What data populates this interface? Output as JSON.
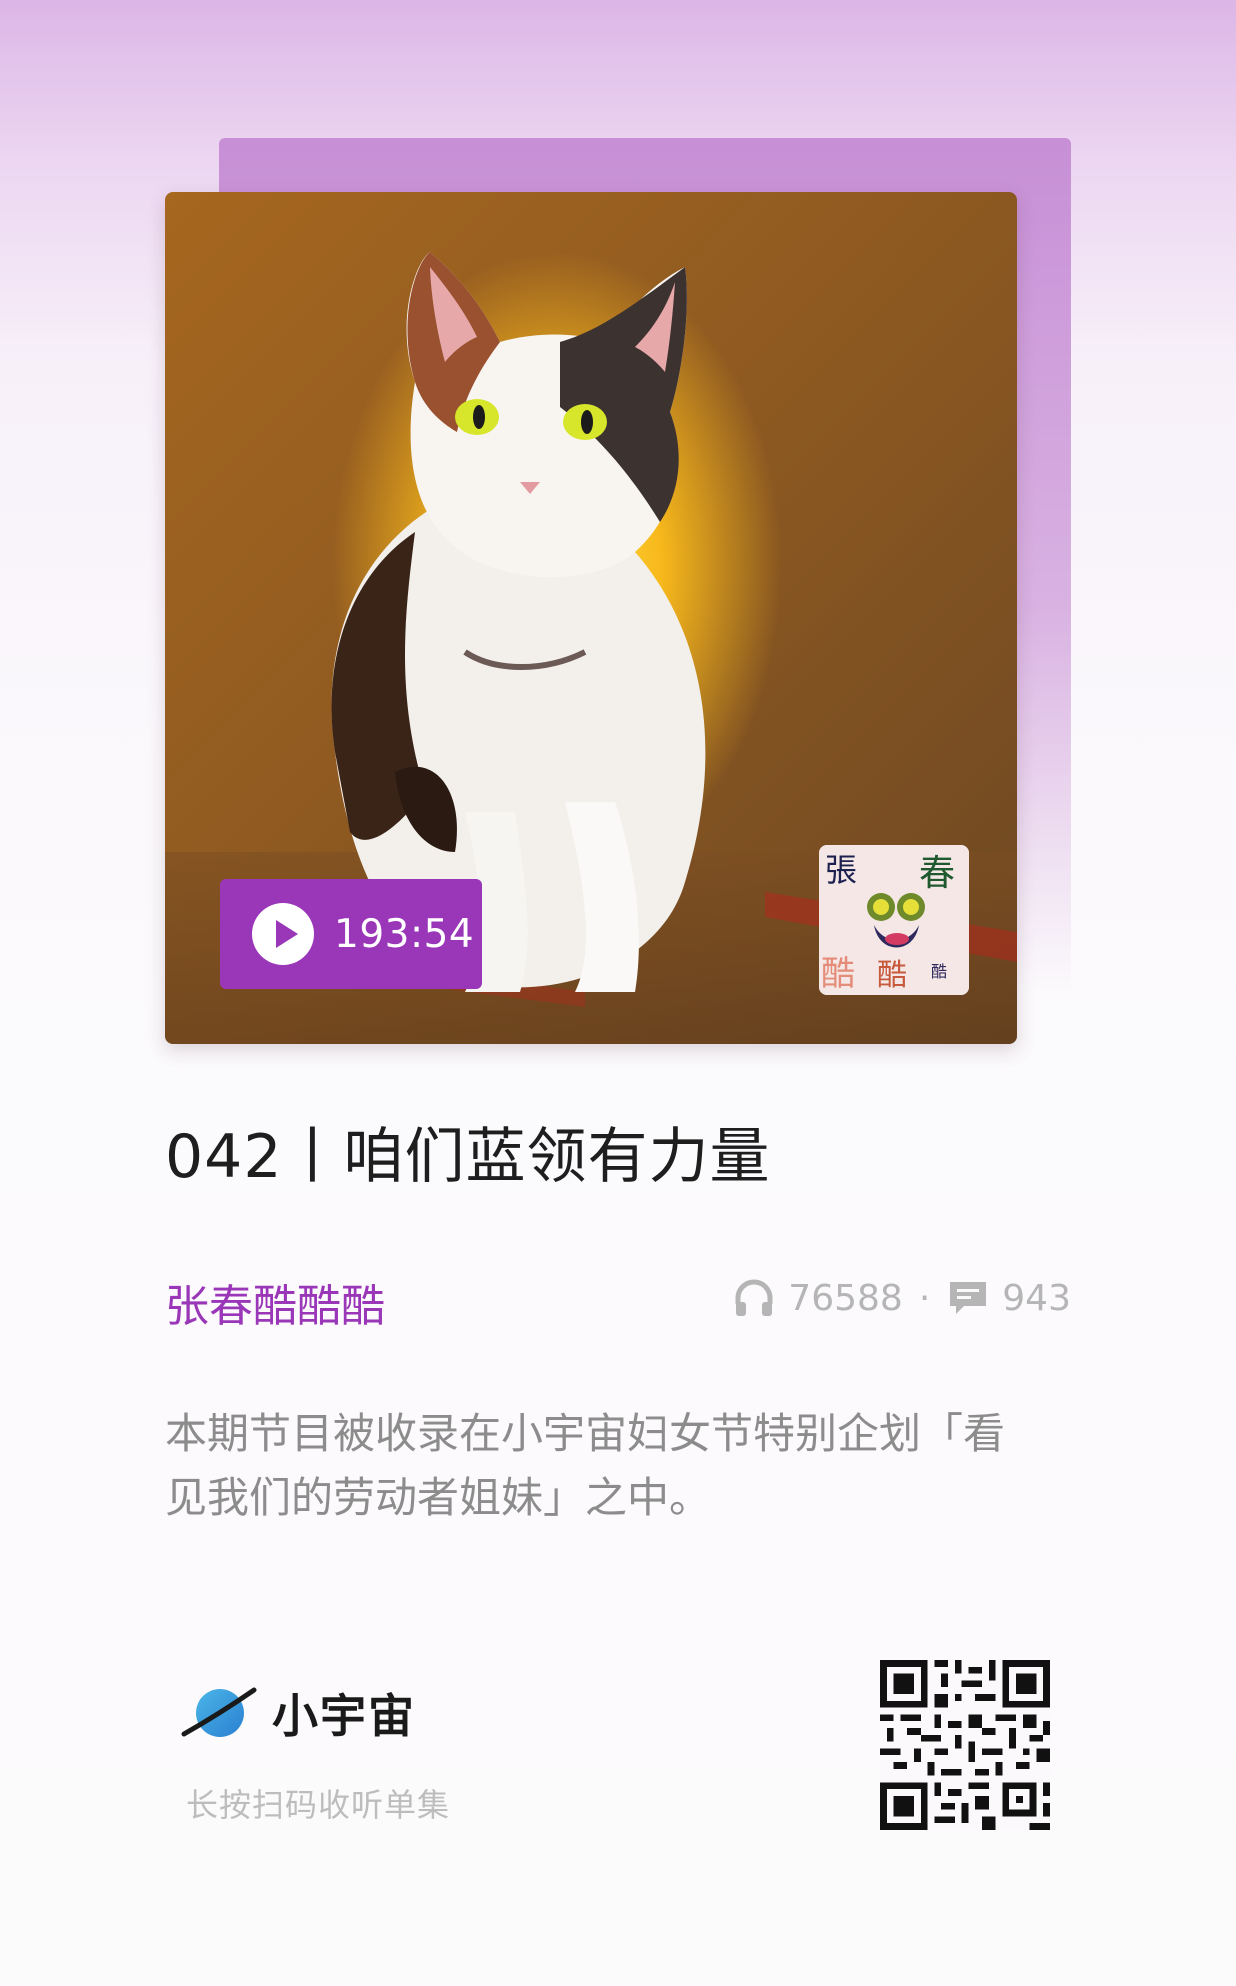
{
  "episode": {
    "duration": "193:54",
    "title": "042丨咱们蓝领有力量",
    "author": "张春酷酷酷",
    "play_count": "76588",
    "separator": "·",
    "comment_count": "943",
    "description": "本期节目被收录在小宇宙妇女节特别企划「看见我们的劳动者姐妹」之中。"
  },
  "stamp": {
    "text": "張春酷酷"
  },
  "footer": {
    "brand": "小宇宙",
    "scan_hint": "长按扫码收听单集"
  },
  "icons": {
    "play": "play-icon",
    "plays": "headphones-icon",
    "comments": "comment-icon",
    "brand": "planet-logo-icon",
    "qr": "qr-code-icon"
  },
  "colors": {
    "accent": "#9a37b9",
    "title": "#1e1e1e",
    "muted": "#8c8c8c"
  }
}
